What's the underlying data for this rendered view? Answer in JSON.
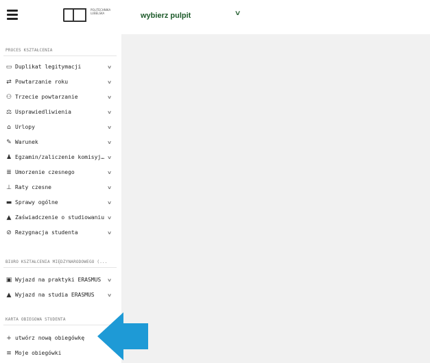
{
  "header": {
    "logo_text": "POLITECHNIKA LUBELSKA",
    "pulpit_label": "wybierz pulpit"
  },
  "colors": {
    "pulpit": "#1d5a2a",
    "main_bg": "#f1f1f1",
    "arrow": "#1e9ad6"
  },
  "sidebar": {
    "section1": "PROCES KSZTAŁCENIA",
    "items1": [
      {
        "label": "Duplikat legitymacji",
        "icon": "card-icon"
      },
      {
        "label": "Powtarzanie roku",
        "icon": "repeat-icon"
      },
      {
        "label": "Trzecie powtarzanie",
        "icon": "users-icon"
      },
      {
        "label": "Usprawiedliwienia",
        "icon": "balance-icon"
      },
      {
        "label": "Urlopy",
        "icon": "home-icon"
      },
      {
        "label": "Warunek",
        "icon": "edit-icon"
      },
      {
        "label": "Egzamin/zaliczenie komisyjne",
        "icon": "user-graduate-icon"
      },
      {
        "label": "Umorzenie czesnego",
        "icon": "documents-icon"
      },
      {
        "label": "Raty czesne",
        "icon": "hand-money-icon"
      },
      {
        "label": "Sprawy ogólne",
        "icon": "folder-icon"
      },
      {
        "label": "Zaświadczenie o studiowaniu",
        "icon": "graduation-cap-icon"
      },
      {
        "label": "Rezygnacja studenta",
        "icon": "ban-icon"
      }
    ],
    "section2": "BIURO KSZTAŁCENIA MIĘDZYNARODOWEGO (...",
    "items2": [
      {
        "label": "Wyjazd na praktyki ERASMUS",
        "icon": "briefcase-icon"
      },
      {
        "label": "Wyjazd na studia ERASMUS",
        "icon": "graduation-cap-icon"
      }
    ],
    "section3": "KARTA OBIEGOWA STUDENTA",
    "items3": [
      {
        "label": "utwórz nową obiegówkę",
        "icon": "plus-icon"
      },
      {
        "label": "Moje obiegówki",
        "icon": "list-icon"
      }
    ]
  }
}
